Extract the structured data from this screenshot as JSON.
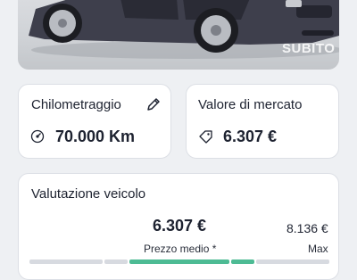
{
  "photo": {
    "watermark": "SUBITO"
  },
  "mileage_card": {
    "title": "Chilometraggio",
    "value": "70.000 Km"
  },
  "market_card": {
    "title": "Valore di mercato",
    "value": "6.307 €"
  },
  "valuation_card": {
    "title": "Valutazione veicolo",
    "average_price": "6.307 €",
    "average_label": "Prezzo medio *",
    "max_price": "8.136 €",
    "max_label": "Max"
  },
  "colors": {
    "accent_green": "#4dbb94",
    "bar_grey": "#d7dae0"
  },
  "icons": [
    "edit-pencil-icon",
    "odometer-icon",
    "price-tag-icon"
  ]
}
